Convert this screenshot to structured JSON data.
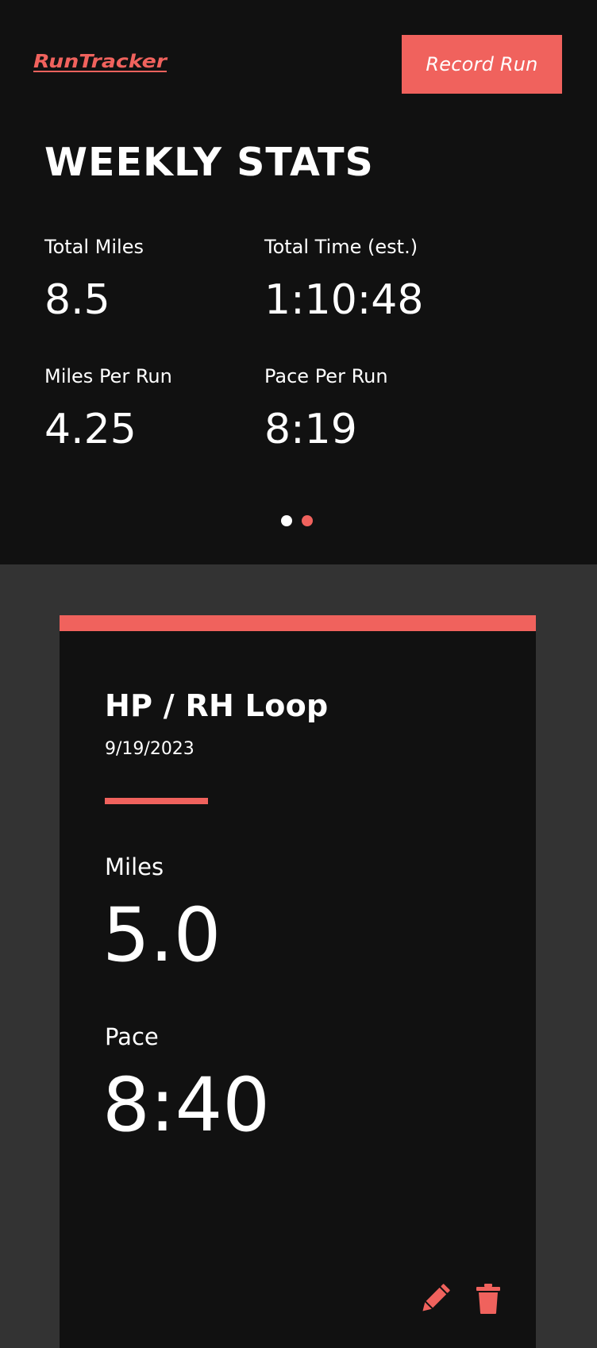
{
  "app": {
    "logo_text": "RunTracker",
    "record_button_label": "Record Run"
  },
  "weekly": {
    "title": "WEEKLY STATS",
    "stats": [
      {
        "label": "Total Miles",
        "value": "8.5"
      },
      {
        "label": "Total Time (est.)",
        "value": "1:10:48"
      },
      {
        "label": "Miles Per Run",
        "value": "4.25"
      },
      {
        "label": "Pace Per Run",
        "value": "8:19"
      }
    ],
    "pagination": {
      "pages": 2,
      "active_page": 2
    }
  },
  "run": {
    "name": "HP / RH Loop",
    "date": "9/19/2023",
    "miles_label": "Miles",
    "miles_value": "5.0",
    "pace_label": "Pace",
    "pace_value": "8:40",
    "actions": {
      "edit_icon": "pencil-icon",
      "delete_icon": "trash-icon"
    }
  },
  "colors": {
    "accent": "#f0625d",
    "panel": "#111111",
    "page_background": "#333333",
    "text": "#ffffff"
  }
}
